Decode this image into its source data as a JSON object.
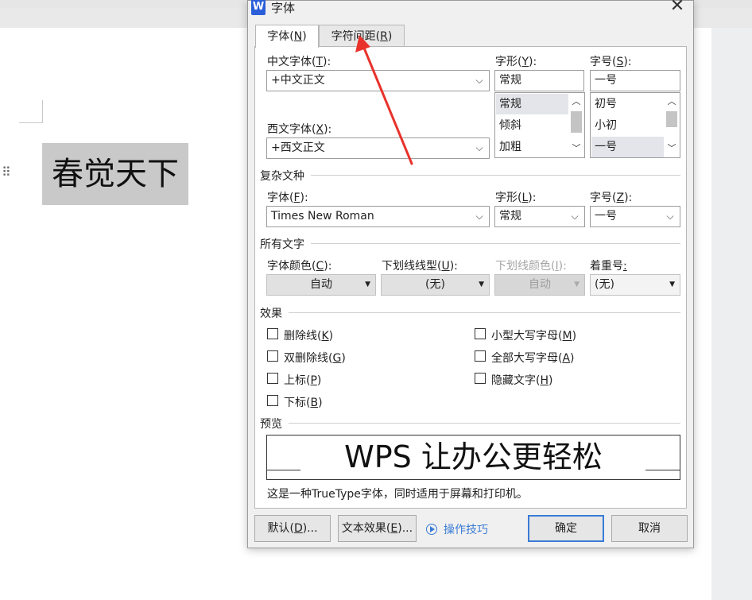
{
  "document": {
    "selected_text": "春觉天下"
  },
  "dialog": {
    "app_icon_letter": "W",
    "title": "字体",
    "close_glyph": "✕",
    "tabs": [
      {
        "label": "字体(",
        "key": "N",
        "tail": ")"
      },
      {
        "label": "字符间距(",
        "key": "R",
        "tail": ")"
      }
    ],
    "chinese_font": {
      "label": "中文字体(",
      "key": "T",
      "tail": "):",
      "value": "+中文正文"
    },
    "style": {
      "label": "字形(",
      "key": "Y",
      "tail": "):",
      "value": "常规",
      "options": [
        "常规",
        "倾斜",
        "加粗"
      ],
      "selected": "常规"
    },
    "size": {
      "label": "字号(",
      "key": "S",
      "tail": "):",
      "value": "一号",
      "options": [
        "初号",
        "小初",
        "一号"
      ],
      "selected": "一号"
    },
    "western_font": {
      "label": "西文字体(",
      "key": "X",
      "tail": "):",
      "value": "+西文正文"
    },
    "complex": {
      "section": "复杂文种",
      "font_label": "字体(",
      "font_key": "F",
      "font_tail": "):",
      "font_value": "Times New Roman",
      "style_label": "字形(",
      "style_key": "L",
      "style_tail": "):",
      "style_value": "常规",
      "size_label": "字号(",
      "size_key": "Z",
      "size_tail": "):",
      "size_value": "一号"
    },
    "all_text": {
      "section": "所有文字",
      "color_label": "字体颜色(",
      "color_key": "C",
      "color_tail": "):",
      "color_value": "自动",
      "underline_label": "下划线线型(",
      "underline_key": "U",
      "underline_tail": "):",
      "underline_value": "(无)",
      "underline_color_label": "下划线颜色(",
      "underline_color_key": "I",
      "underline_color_tail": "):",
      "underline_color_value": "自动",
      "emphasis_label": "着重号",
      "emphasis_tail": ":",
      "emphasis_value": "(无)"
    },
    "effects": {
      "section": "效果",
      "items": [
        {
          "label": "删除线(",
          "key": "K",
          "tail": ")",
          "checked": false
        },
        {
          "label": "双删除线(",
          "key": "G",
          "tail": ")",
          "checked": false
        },
        {
          "label": "上标(",
          "key": "P",
          "tail": ")",
          "checked": false
        },
        {
          "label": "下标(",
          "key": "B",
          "tail": ")",
          "checked": false
        },
        {
          "label": "小型大写字母(",
          "key": "M",
          "tail": ")",
          "checked": false
        },
        {
          "label": "全部大写字母(",
          "key": "A",
          "tail": ")",
          "checked": false
        },
        {
          "label": "隐藏文字(",
          "key": "H",
          "tail": ")",
          "checked": false
        }
      ]
    },
    "preview": {
      "section": "预览",
      "text": "WPS 让办公更轻松",
      "note": "这是一种TrueType字体，同时适用于屏幕和打印机。"
    },
    "buttons": {
      "default_label": "默认(",
      "default_key": "D",
      "default_tail": ")...",
      "effects_label": "文本效果(",
      "effects_key": "E",
      "effects_tail": ")...",
      "tips_label": "操作技巧",
      "ok_label": "确定",
      "cancel_label": "取消"
    }
  },
  "colors": {
    "accent": "#3a7bd5",
    "annotation_arrow": "#e8322b",
    "selection_highlight": "#c9c9c9"
  }
}
